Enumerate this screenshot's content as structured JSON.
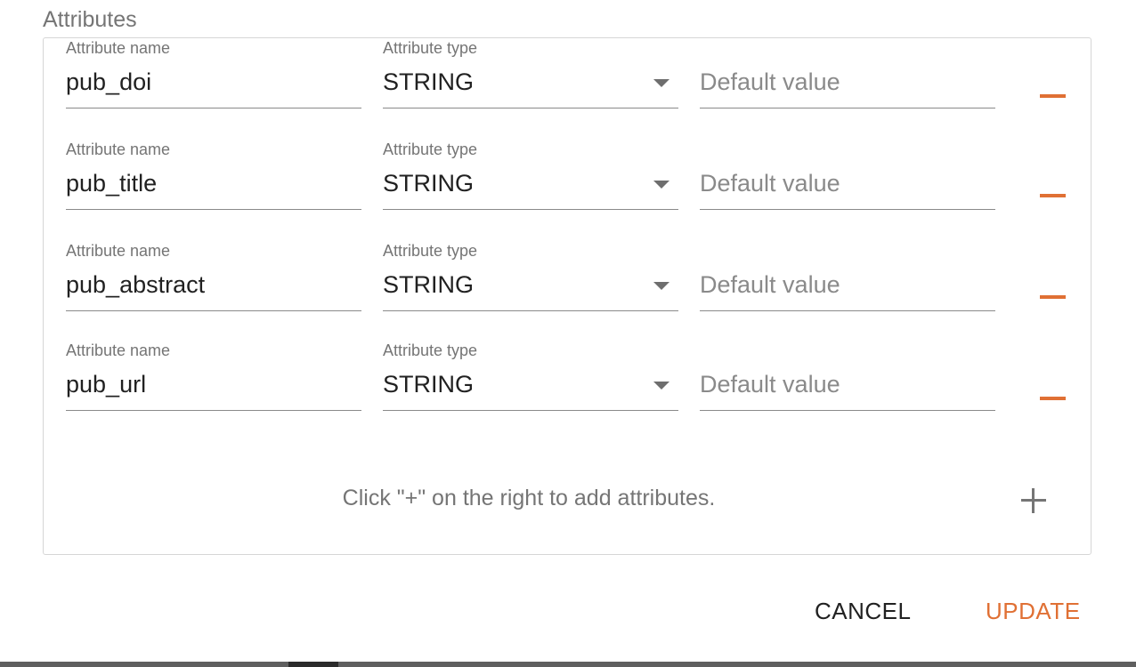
{
  "section_title": "Attributes",
  "accent_color": "#e07034",
  "attributes": [
    {
      "name_label": "Attribute name",
      "name_value": "pub_doi",
      "type_label": "Attribute type",
      "type_value": "STRING",
      "default_placeholder": "Default value",
      "remove_icon": "minus-icon"
    },
    {
      "name_label": "Attribute name",
      "name_value": "pub_title",
      "type_label": "Attribute type",
      "type_value": "STRING",
      "default_placeholder": "Default value",
      "remove_icon": "minus-icon"
    },
    {
      "name_label": "Attribute name",
      "name_value": "pub_abstract",
      "type_label": "Attribute type",
      "type_value": "STRING",
      "default_placeholder": "Default value",
      "remove_icon": "minus-icon"
    },
    {
      "name_label": "Attribute name",
      "name_value": "pub_url",
      "type_label": "Attribute type",
      "type_value": "STRING",
      "default_placeholder": "Default value",
      "remove_icon": "minus-icon"
    }
  ],
  "hint_text": "Click \"+\" on the right to add attributes.",
  "add_icon": "plus-icon",
  "actions": {
    "cancel_label": "CANCEL",
    "update_label": "UPDATE"
  }
}
